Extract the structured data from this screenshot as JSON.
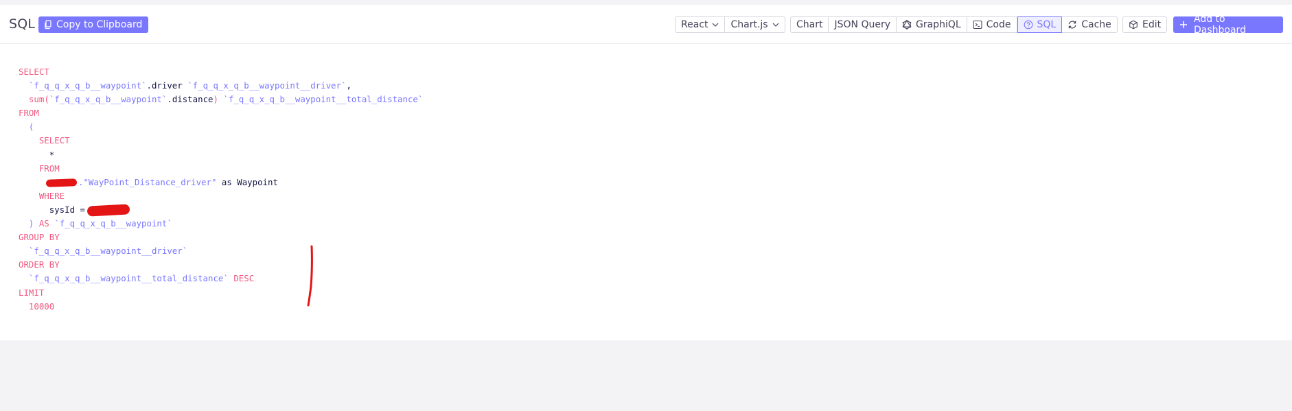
{
  "header": {
    "title": "SQL",
    "copy_label": "Copy to Clipboard",
    "framework_select": "React",
    "library_select": "Chart.js",
    "tabs": [
      "Chart",
      "JSON Query",
      "GraphiQL",
      "Code",
      "SQL",
      "Cache"
    ],
    "active_tab": "SQL",
    "edit_label": "Edit",
    "add_label": "Add to Dashboard"
  },
  "icons": {
    "copy": "clipboard-icon",
    "graphiql": "graphql-icon",
    "code": "terminal-icon",
    "sql": "question-circle-icon",
    "cache": "refresh-icon",
    "edit": "cube-icon",
    "add": "plus-icon"
  },
  "colors": {
    "accent": "#7a77ff",
    "keyword": "#f05880",
    "text": "#141446",
    "redaction": "#e31515"
  },
  "sql": {
    "l1": "SELECT",
    "l2_id": "`f_q_q_x_q_b__waypoint`",
    "l2_col": ".driver ",
    "l2_alias": "`f_q_q_x_q_b__waypoint__driver`",
    "l2_comma": ",",
    "l3_fn": "sum",
    "l3_open": "(",
    "l3_id": "`f_q_q_x_q_b__waypoint`",
    "l3_col": ".distance",
    "l3_close": ") ",
    "l3_alias": "`f_q_q_x_q_b__waypoint__total_distance`",
    "l4": "FROM",
    "l5": "(",
    "l6": "SELECT",
    "l7": "*",
    "l8": "FROM",
    "l9_table": ".\"WayPoint_Distance_driver\"",
    "l9_rest": " as Waypoint",
    "l10": "WHERE",
    "l11": "sysId =",
    "l12_close": ") ",
    "l12_as": "AS ",
    "l12_alias": "`f_q_q_x_q_b__waypoint`",
    "l13": "GROUP BY",
    "l14": "`f_q_q_x_q_b__waypoint__driver`",
    "l15": "ORDER BY",
    "l16_alias": "`f_q_q_x_q_b__waypoint__total_distance`",
    "l16_desc": " DESC",
    "l17": "LIMIT",
    "l18": "10000"
  }
}
